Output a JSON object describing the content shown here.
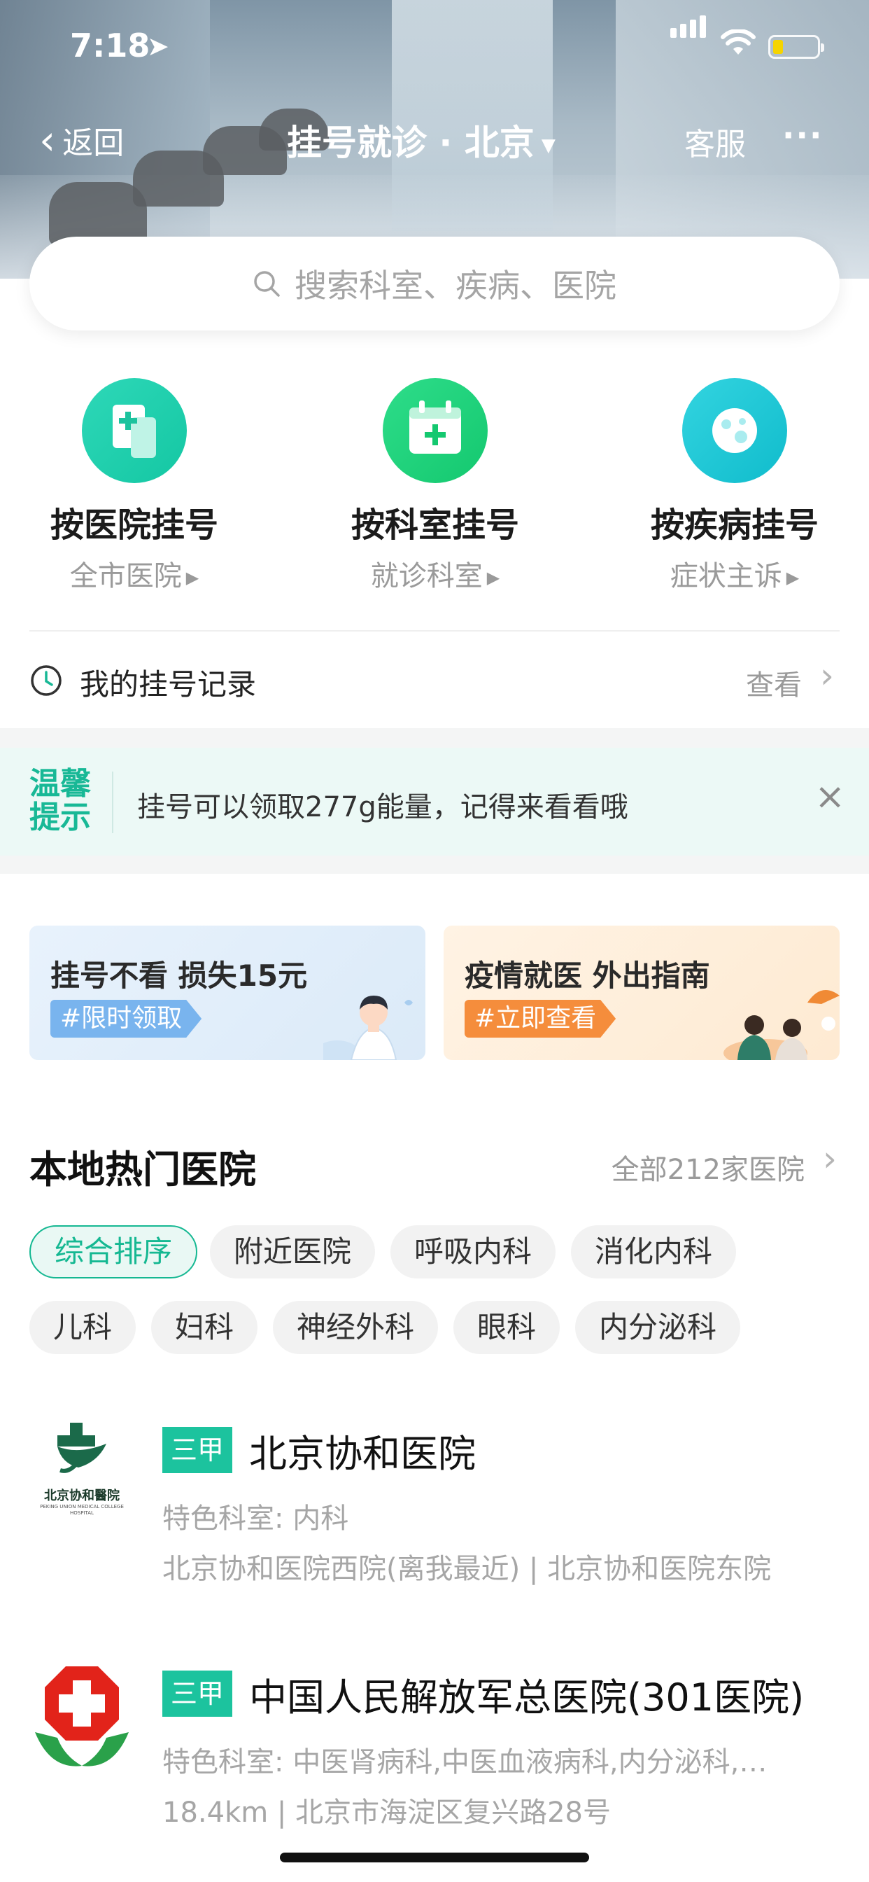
{
  "status_bar": {
    "time": "7:18"
  },
  "nav": {
    "back_label": "返回",
    "title": "挂号就诊 · 北京",
    "service_label": "客服",
    "more_label": "···"
  },
  "search": {
    "placeholder": "搜索科室、疾病、医院"
  },
  "quick_entries": [
    {
      "label": "按医院挂号",
      "sub": "全市医院",
      "icon": "hospital-icon"
    },
    {
      "label": "按科室挂号",
      "sub": "就诊科室",
      "icon": "calendar-plus-icon"
    },
    {
      "label": "按疾病挂号",
      "sub": "症状主诉",
      "icon": "virus-icon"
    }
  ],
  "record": {
    "label": "我的挂号记录",
    "action": "查看"
  },
  "tip": {
    "badge_line1": "温馨",
    "badge_line2": "提示",
    "message": "挂号可以领取277g能量，记得来看看哦"
  },
  "promo_cards": [
    {
      "title": "挂号不看 损失15元",
      "tag": "#限时领取"
    },
    {
      "title": "疫情就医 外出指南",
      "tag": "#立即查看"
    }
  ],
  "section": {
    "title": "本地热门医院",
    "more": "全部212家医院"
  },
  "chips": [
    "综合排序",
    "附近医院",
    "呼吸内科",
    "消化内科",
    "儿科",
    "妇科",
    "神经外科",
    "眼科",
    "内分泌科"
  ],
  "hospitals": [
    {
      "level": "三甲",
      "name": "北京协和医院",
      "specialty": "特色科室: 内科",
      "address": "北京协和医院西院(离我最近) | 北京协和医院东院",
      "logo_text": "北京协和醫院",
      "logo_en": "PEKING UNION MEDICAL COLLEGE HOSPITAL"
    },
    {
      "level": "三甲",
      "name": "中国人民解放军总医院(301医院)",
      "specialty": "特色科室: 中医肾病科,中医血液病科,内分泌科,…",
      "address": "18.4km | 北京市海淀区复兴路28号"
    }
  ],
  "colors": {
    "accent": "#1cc39e",
    "tip_bg": "#ecf9f6",
    "orange": "#f58d3c",
    "blue_tag": "#79b4ee"
  }
}
